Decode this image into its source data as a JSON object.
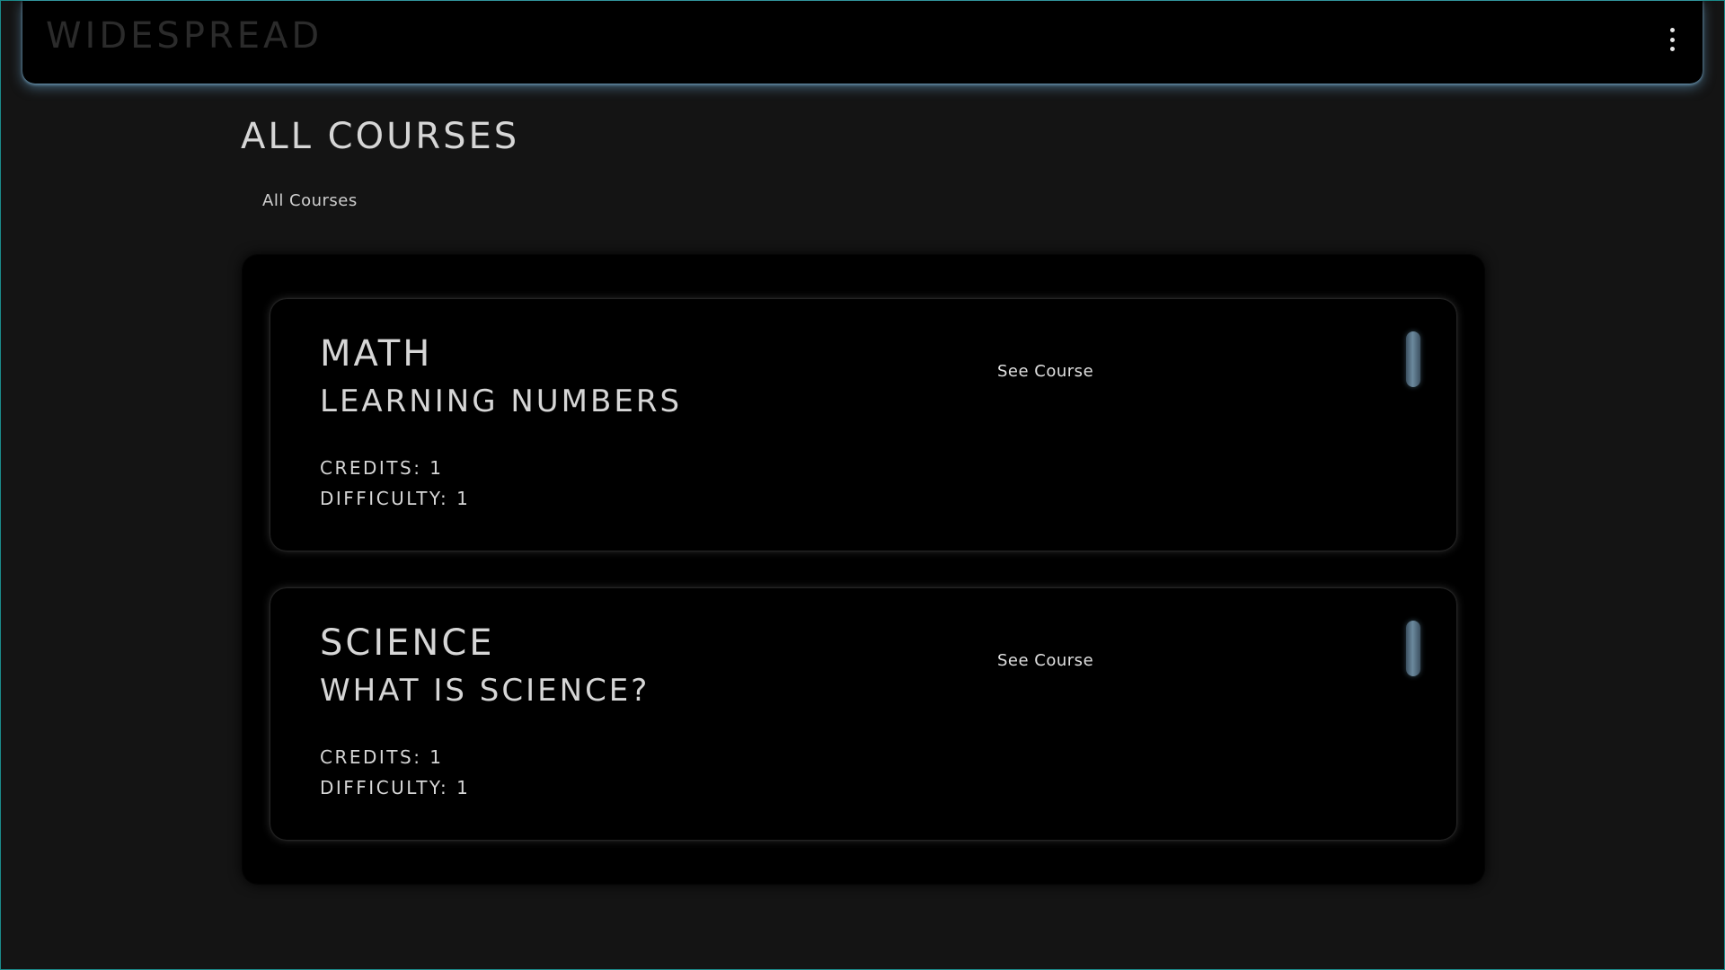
{
  "header": {
    "brand": "WIDESPREAD",
    "menu_icon": "more-vertical-icon"
  },
  "page": {
    "title": "ALL COURSES",
    "breadcrumb": "All Courses"
  },
  "courses": [
    {
      "subject": "MATH",
      "name": "LEARNING NUMBERS",
      "credits": "CREDITS: 1",
      "difficulty": "DIFFICULTY: 1",
      "action_label": "See Course"
    },
    {
      "subject": "SCIENCE",
      "name": "WHAT IS SCIENCE?",
      "credits": "CREDITS: 1",
      "difficulty": "DIFFICULTY: 1",
      "action_label": "See Course"
    }
  ],
  "colors": {
    "background": "#141414",
    "surface": "#000000",
    "accent_glow": "#6ea9d2",
    "text": "#d6d6d6",
    "brand_text": "#2b2b2b"
  }
}
